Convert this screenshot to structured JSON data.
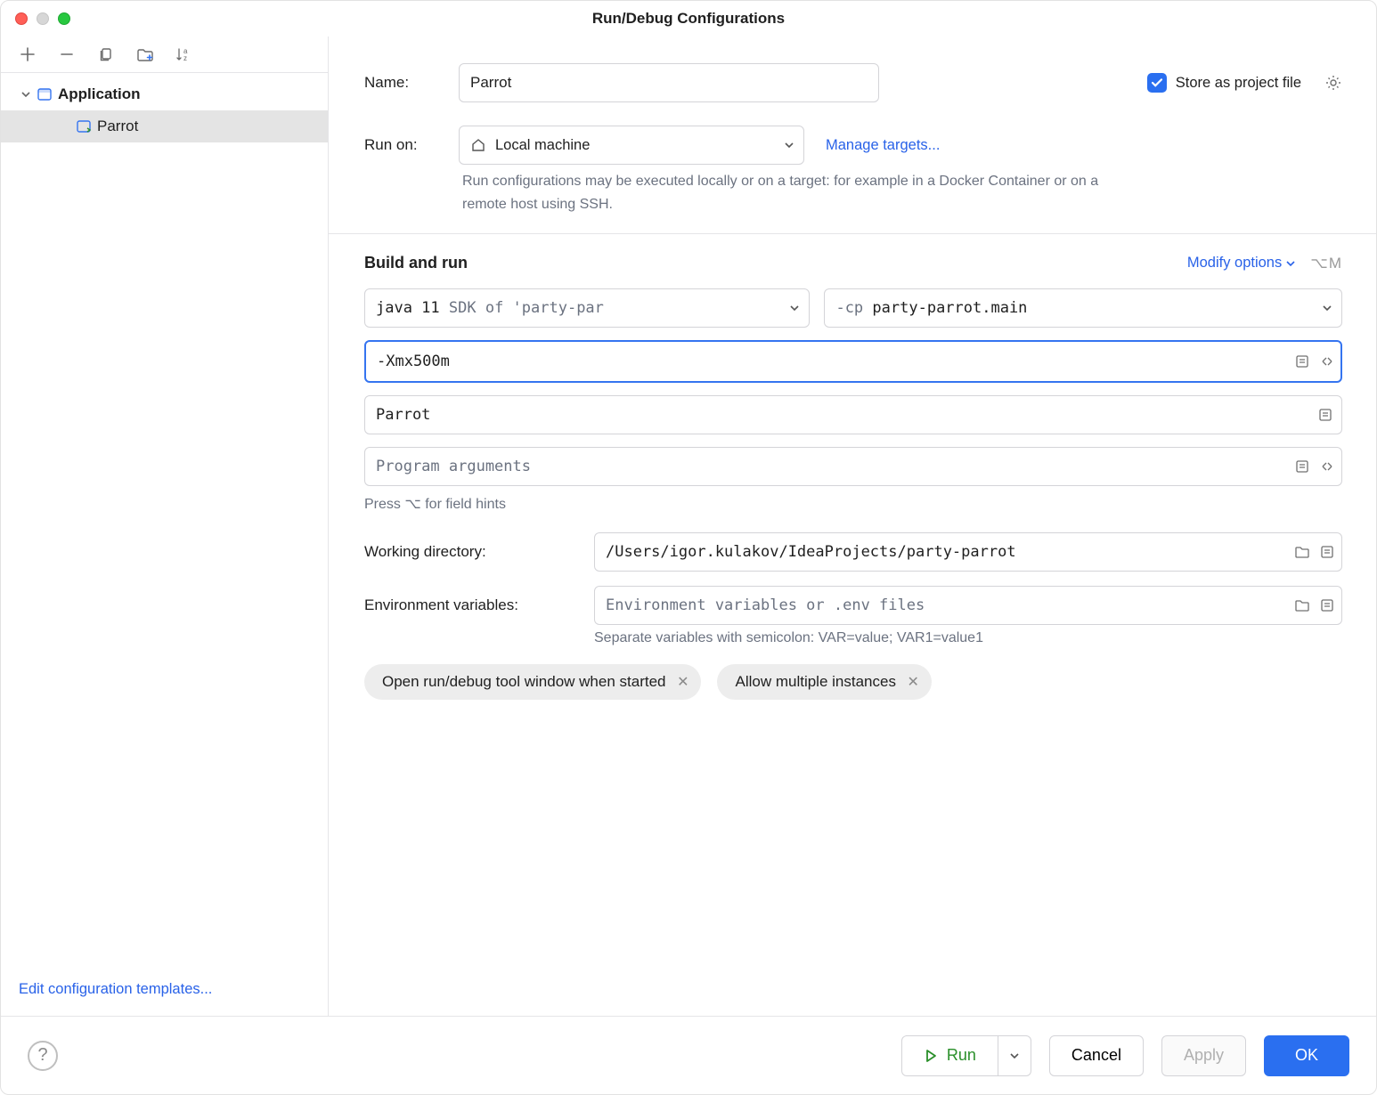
{
  "window": {
    "title": "Run/Debug Configurations"
  },
  "sidebar": {
    "root": {
      "label": "Application"
    },
    "items": [
      {
        "label": "Parrot"
      }
    ],
    "edit_templates": "Edit configuration templates..."
  },
  "form": {
    "name_label": "Name:",
    "name_value": "Parrot",
    "store_label": "Store as project file",
    "run_on_label": "Run on:",
    "run_on_value": "Local machine",
    "manage_targets": "Manage targets...",
    "run_on_hint": "Run configurations may be executed locally or on a target: for example in a Docker Container or on a remote host using SSH."
  },
  "build": {
    "section_title": "Build and run",
    "modify_options": "Modify options",
    "shortcut": "⌥M",
    "jdk_prefix": "java 11",
    "jdk_suffix": "SDK of 'party-par",
    "cp_prefix": "-cp",
    "cp_value": "party-parrot.main",
    "vm_options": "-Xmx500m",
    "main_class": "Parrot",
    "program_args_placeholder": "Program arguments",
    "field_hints": "Press ⌥ for field hints",
    "working_dir_label": "Working directory:",
    "working_dir_value": "/Users/igor.kulakov/IdeaProjects/party-parrot",
    "env_label": "Environment variables:",
    "env_placeholder": "Environment variables or .env files",
    "env_hint": "Separate variables with semicolon: VAR=value; VAR1=value1",
    "chips": [
      "Open run/debug tool window when started",
      "Allow multiple instances"
    ]
  },
  "footer": {
    "run": "Run",
    "cancel": "Cancel",
    "apply": "Apply",
    "ok": "OK"
  }
}
